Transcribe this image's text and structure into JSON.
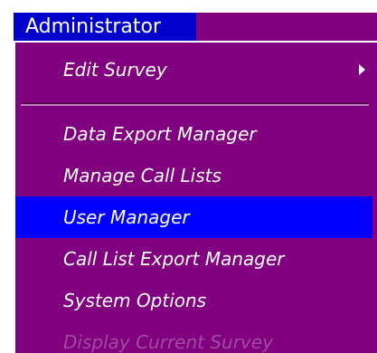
{
  "menubar": {
    "title": "Administrator"
  },
  "menu": {
    "items": [
      {
        "label": "Edit Survey",
        "has_submenu": true
      },
      {
        "label": "Data Export Manager"
      },
      {
        "label": "Manage Call Lists"
      },
      {
        "label": "User Manager",
        "highlighted": true
      },
      {
        "label": "Call List Export Manager"
      },
      {
        "label": "System Options"
      },
      {
        "label": "Display Current Survey",
        "disabled": true
      }
    ]
  },
  "colors": {
    "menu_background": "#800080",
    "highlight": "#0000ff",
    "title_background": "#0000cc",
    "text": "#ffffff",
    "disabled_text": "#a04aa0"
  },
  "icons": {
    "submenu": "chevron-right-icon"
  }
}
